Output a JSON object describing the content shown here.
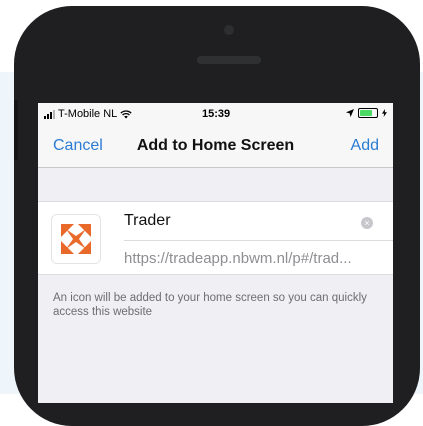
{
  "status_bar": {
    "carrier": "T-Mobile NL",
    "time": "15:39",
    "icons": [
      "signal-icon",
      "wifi-icon",
      "location-arrow-icon",
      "battery-icon"
    ]
  },
  "nav": {
    "cancel_label": "Cancel",
    "title": "Add to Home Screen",
    "add_label": "Add"
  },
  "app": {
    "name": "Trader",
    "url": "https://tradeapp.nbwm.nl/p#/trad...",
    "icon_color": "#e8692a"
  },
  "help_text": "An icon will be added to your home screen so you can quickly access this website",
  "colors": {
    "ios_blue": "#2b7cd3",
    "phone_body": "#1f1f21",
    "background": "#eef6fc"
  }
}
